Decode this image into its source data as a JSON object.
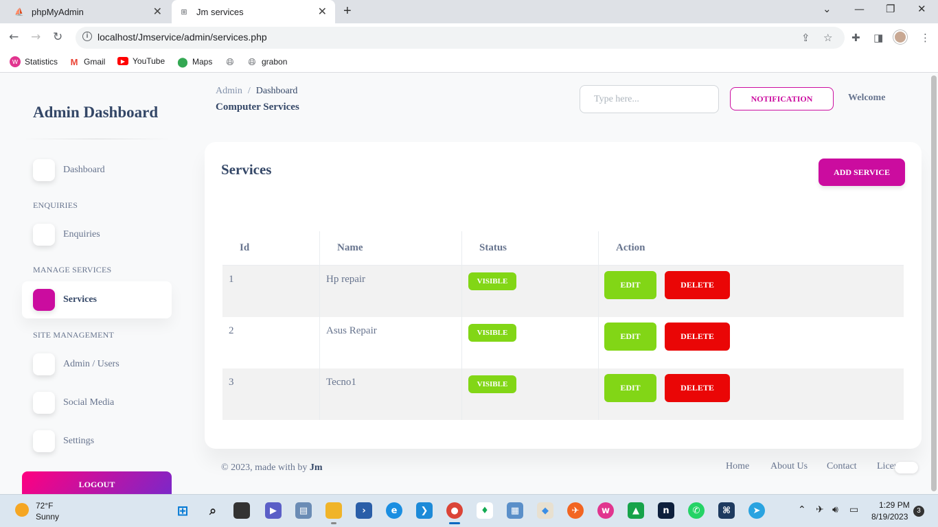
{
  "browser": {
    "tabs": [
      {
        "title": "phpMyAdmin",
        "active": false,
        "icon": "phpmyadmin-icon"
      },
      {
        "title": "Jm services",
        "active": true,
        "icon": "globe-icon"
      }
    ],
    "url": "localhost/Jmservice/admin/services.php",
    "bookmarks": [
      {
        "label": "Statistics",
        "icon": "wamp-icon"
      },
      {
        "label": "Gmail",
        "icon": "gmail-icon"
      },
      {
        "label": "YouTube",
        "icon": "youtube-icon"
      },
      {
        "label": "Maps",
        "icon": "maps-icon"
      },
      {
        "label": "",
        "icon": "globe-icon"
      },
      {
        "label": "grabon",
        "icon": "globe-icon"
      }
    ]
  },
  "sidebar": {
    "title": "Admin Dashboard",
    "items": {
      "dashboard": "Dashboard",
      "enquiries_heading": "ENQUIRIES",
      "enquiries": "Enquiries",
      "manage_heading": "MANAGE SERVICES",
      "services": "Services",
      "site_heading": "SITE MANAGEMENT",
      "admin_users": "Admin / Users",
      "social_media": "Social Media",
      "settings": "Settings"
    },
    "logout": "LOGOUT",
    "active_item": "Services",
    "accent_color": "#cb0c9f"
  },
  "header": {
    "breadcrumb": {
      "root": "Admin",
      "separator": "/",
      "current": "Dashboard"
    },
    "subtitle": "Computer Services",
    "search_placeholder": "Type here...",
    "notification": "NOTIFICATION",
    "welcome": "Welcome"
  },
  "card": {
    "title": "Services",
    "add_button": "ADD SERVICE",
    "table": {
      "headers": {
        "id": "Id",
        "name": "Name",
        "status": "Status",
        "action": "Action"
      },
      "rows": [
        {
          "id": "1",
          "name": "Hp repair",
          "status": "VISIBLE",
          "edit": "EDIT",
          "delete": "DELETE"
        },
        {
          "id": "2",
          "name": "Asus Repair",
          "status": "VISIBLE",
          "edit": "EDIT",
          "delete": "DELETE"
        },
        {
          "id": "3",
          "name": "Tecno1",
          "status": "VISIBLE",
          "edit": "EDIT",
          "delete": "DELETE"
        }
      ]
    },
    "colors": {
      "visible": "#82d616",
      "edit": "#82d616",
      "delete": "#ea0606"
    }
  },
  "footer": {
    "copy_prefix": "© 2023, made with by",
    "author": "Jm",
    "links": {
      "home": "Home",
      "about": "About Us",
      "contact": "Contact",
      "license": "Licer"
    }
  },
  "taskbar": {
    "weather_temp": "72°F",
    "weather_desc": "Sunny",
    "time": "1:29 PM",
    "date": "8/19/2023",
    "notifications": "3"
  }
}
